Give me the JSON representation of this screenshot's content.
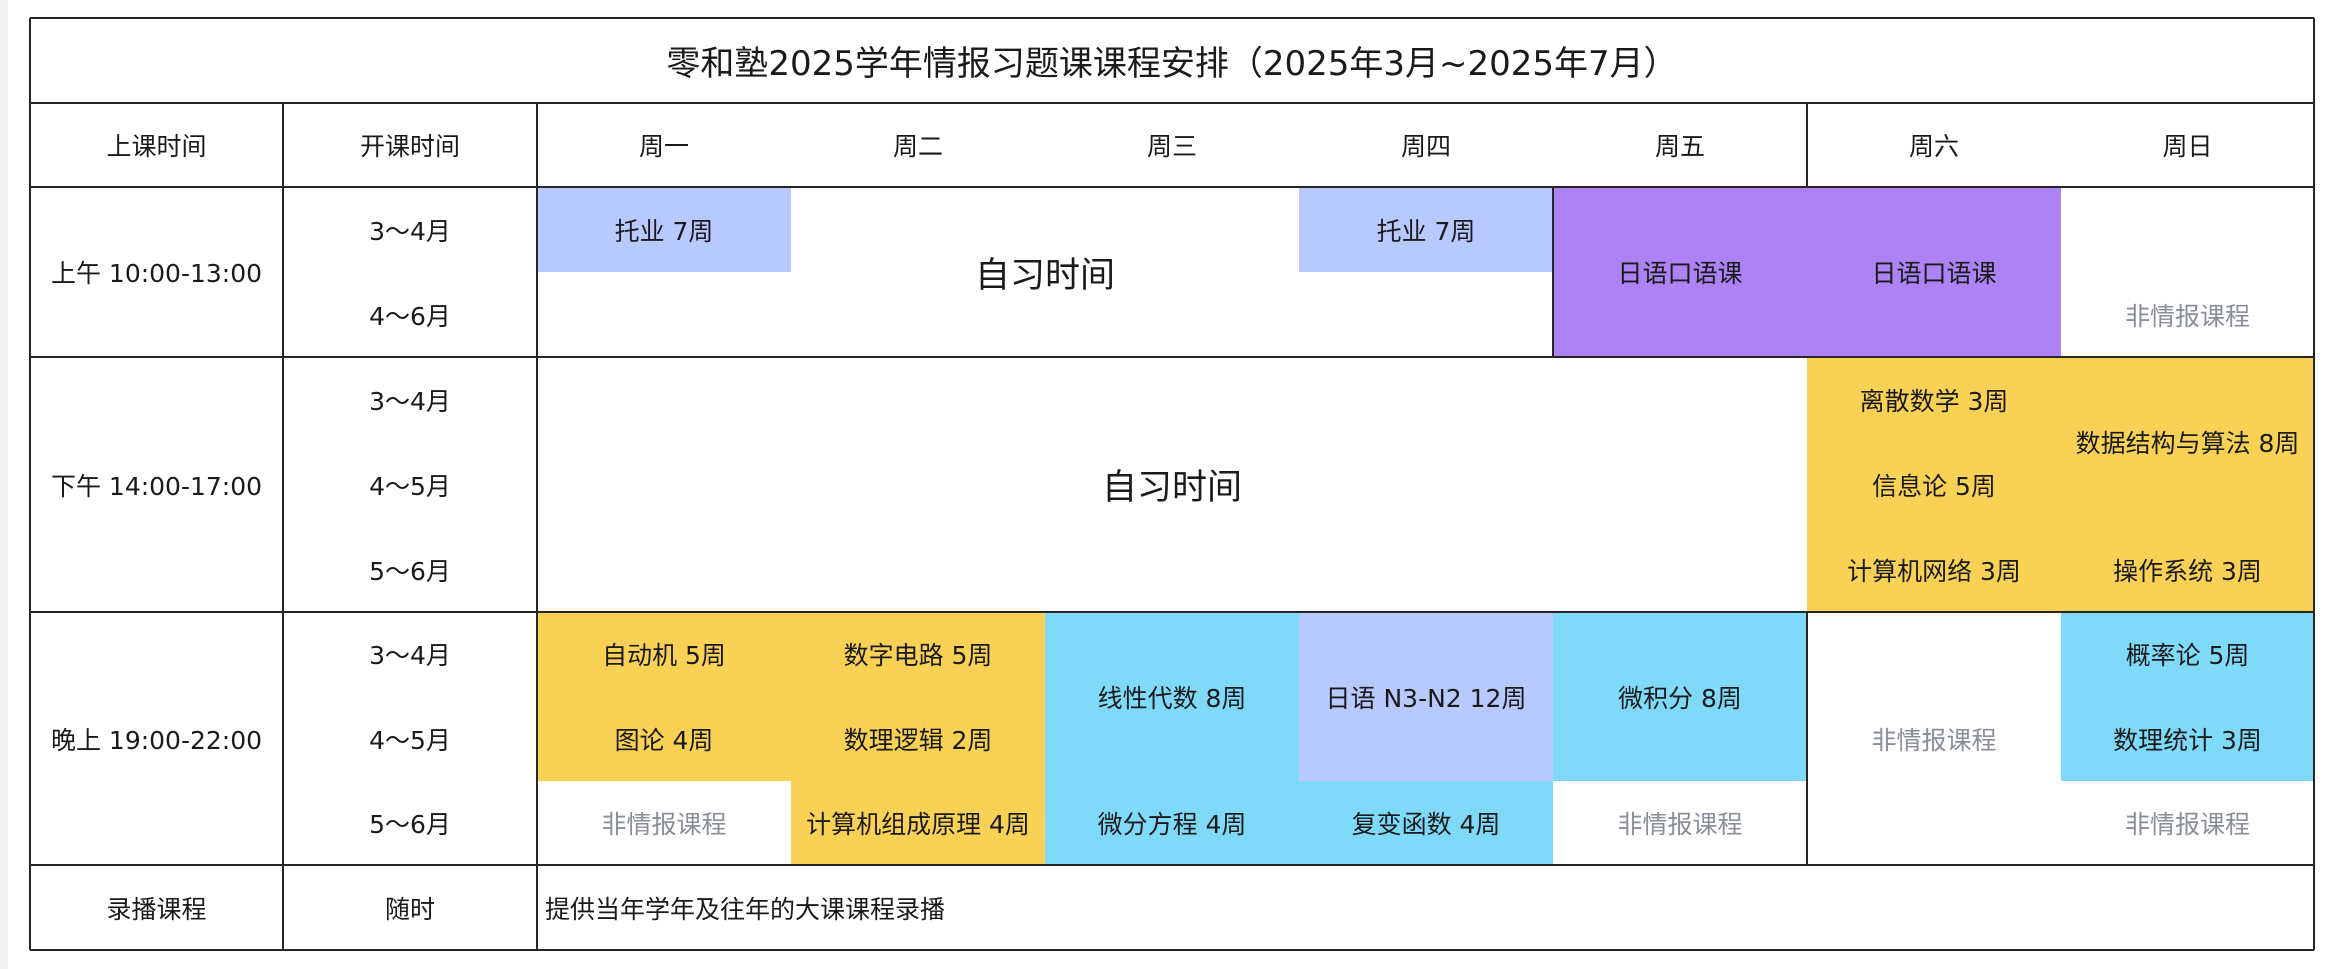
{
  "title": "零和塾2025学年情报习题课课程安排（2025年3月~2025年7月）",
  "colors": {
    "blue": "#b8c9ff",
    "purple": "#ac82f5",
    "yellow": "#f9d154",
    "cyan": "#7fdafa",
    "white": "#ffffff",
    "lines": "#262626",
    "grey_text": "#8a8e96"
  },
  "header": {
    "time_label": "上课时间",
    "open_label": "开课时间",
    "days": [
      "周一",
      "周二",
      "周三",
      "周四",
      "周五",
      "周六",
      "周日"
    ]
  },
  "sessions": [
    {
      "name": "morning",
      "time": "上午 10:00-13:00",
      "periods": [
        "3～4月",
        "4～6月"
      ]
    },
    {
      "name": "afternoon",
      "time": "下午 14:00-17:00",
      "periods": [
        "3～4月",
        "4～5月",
        "5～6月"
      ]
    },
    {
      "name": "evening",
      "time": "晚上 19:00-22:00",
      "periods": [
        "3～4月",
        "4～5月",
        "5～6月"
      ]
    }
  ],
  "recorded": {
    "label": "录播课程",
    "open": "随时",
    "note": "提供当年学年及往年的大课课程录播"
  },
  "blocks": [
    {
      "name": "mon-morning-toefl",
      "text": "托业 7周",
      "day": 0,
      "span": 1,
      "row": 0,
      "rows": 1,
      "color": "blue"
    },
    {
      "name": "morning-self-study",
      "text": "自习时间",
      "day": 1,
      "span": 2,
      "row": 0,
      "rows": 2,
      "color": "white",
      "style": "big"
    },
    {
      "name": "thu-morning-toefl",
      "text": "托业 7周",
      "day": 3,
      "span": 1,
      "row": 0,
      "rows": 1,
      "color": "blue"
    },
    {
      "name": "fri-morning-japanese-oral",
      "text": "日语口语课",
      "day": 4,
      "span": 1,
      "row": 0,
      "rows": 2,
      "color": "purple"
    },
    {
      "name": "sat-morning-japanese-oral",
      "text": "日语口语课",
      "day": 5,
      "span": 1,
      "row": 0,
      "rows": 2,
      "color": "purple"
    },
    {
      "name": "sun-morning-non-info",
      "text": "非情报课程",
      "day": 6,
      "span": 1,
      "row": 1,
      "rows": 1,
      "color": "white",
      "style": "grey"
    },
    {
      "name": "afternoon-self-study",
      "text": "自习时间",
      "day": 0,
      "span": 5,
      "row": 2,
      "rows": 3,
      "color": "white",
      "style": "big"
    },
    {
      "name": "sat-discrete-math",
      "text": "离散数学 3周",
      "day": 5,
      "span": 1,
      "row": 2,
      "rows": 1,
      "color": "yellow"
    },
    {
      "name": "sat-information-theory",
      "text": "信息论 5周",
      "day": 5,
      "span": 1,
      "row": 3,
      "rows": 1,
      "color": "yellow"
    },
    {
      "name": "sat-computer-network",
      "text": "计算机网络 3周",
      "day": 5,
      "span": 1,
      "row": 4,
      "rows": 1,
      "color": "yellow"
    },
    {
      "name": "sun-data-structures",
      "text": "数据结构与算法 8周",
      "day": 6,
      "span": 1,
      "row": 2,
      "rows": 2,
      "color": "yellow"
    },
    {
      "name": "sun-operating-system",
      "text": "操作系统 3周",
      "day": 6,
      "span": 1,
      "row": 4,
      "rows": 1,
      "color": "yellow"
    },
    {
      "name": "mon-automata",
      "text": "自动机 5周",
      "day": 0,
      "span": 1,
      "row": 5,
      "rows": 1,
      "color": "yellow"
    },
    {
      "name": "mon-graph-theory",
      "text": "图论 4周",
      "day": 0,
      "span": 1,
      "row": 6,
      "rows": 1,
      "color": "yellow"
    },
    {
      "name": "mon-evening-non-info",
      "text": "非情报课程",
      "day": 0,
      "span": 1,
      "row": 7,
      "rows": 1,
      "color": "white",
      "style": "grey"
    },
    {
      "name": "tue-digital-circuits",
      "text": "数字电路 5周",
      "day": 1,
      "span": 1,
      "row": 5,
      "rows": 1,
      "color": "yellow"
    },
    {
      "name": "tue-mathematical-logic",
      "text": "数理逻辑 2周",
      "day": 1,
      "span": 1,
      "row": 6,
      "rows": 1,
      "color": "yellow"
    },
    {
      "name": "tue-computer-organization",
      "text": "计算机组成原理 4周",
      "day": 1,
      "span": 1,
      "row": 7,
      "rows": 1,
      "color": "yellow"
    },
    {
      "name": "wed-linear-algebra",
      "text": "线性代数 8周",
      "day": 2,
      "span": 1,
      "row": 5,
      "rows": 2,
      "color": "cyan"
    },
    {
      "name": "wed-differential-equations",
      "text": "微分方程 4周",
      "day": 2,
      "span": 1,
      "row": 7,
      "rows": 1,
      "color": "cyan"
    },
    {
      "name": "thu-japanese-n3-n2",
      "text": "日语 N3-N2 12周",
      "day": 3,
      "span": 1,
      "row": 5,
      "rows": 2,
      "color": "blue"
    },
    {
      "name": "thu-complex-functions",
      "text": "复变函数 4周",
      "day": 3,
      "span": 1,
      "row": 7,
      "rows": 1,
      "color": "cyan"
    },
    {
      "name": "fri-calculus",
      "text": "微积分 8周",
      "day": 4,
      "span": 1,
      "row": 5,
      "rows": 2,
      "color": "cyan"
    },
    {
      "name": "fri-evening-non-info",
      "text": "非情报课程",
      "day": 4,
      "span": 1,
      "row": 7,
      "rows": 1,
      "color": "white",
      "style": "grey"
    },
    {
      "name": "sat-evening-non-info",
      "text": "非情报课程",
      "day": 5,
      "span": 1,
      "row": 5,
      "rows": 3,
      "color": "white",
      "style": "grey"
    },
    {
      "name": "sun-probability",
      "text": "概率论 5周",
      "day": 6,
      "span": 1,
      "row": 5,
      "rows": 1,
      "color": "cyan"
    },
    {
      "name": "sun-mathematical-statistics",
      "text": "数理统计 3周",
      "day": 6,
      "span": 1,
      "row": 6,
      "rows": 1,
      "color": "cyan"
    },
    {
      "name": "sun-evening-non-info",
      "text": "非情报课程",
      "day": 6,
      "span": 1,
      "row": 7,
      "rows": 1,
      "color": "white",
      "style": "grey"
    }
  ]
}
